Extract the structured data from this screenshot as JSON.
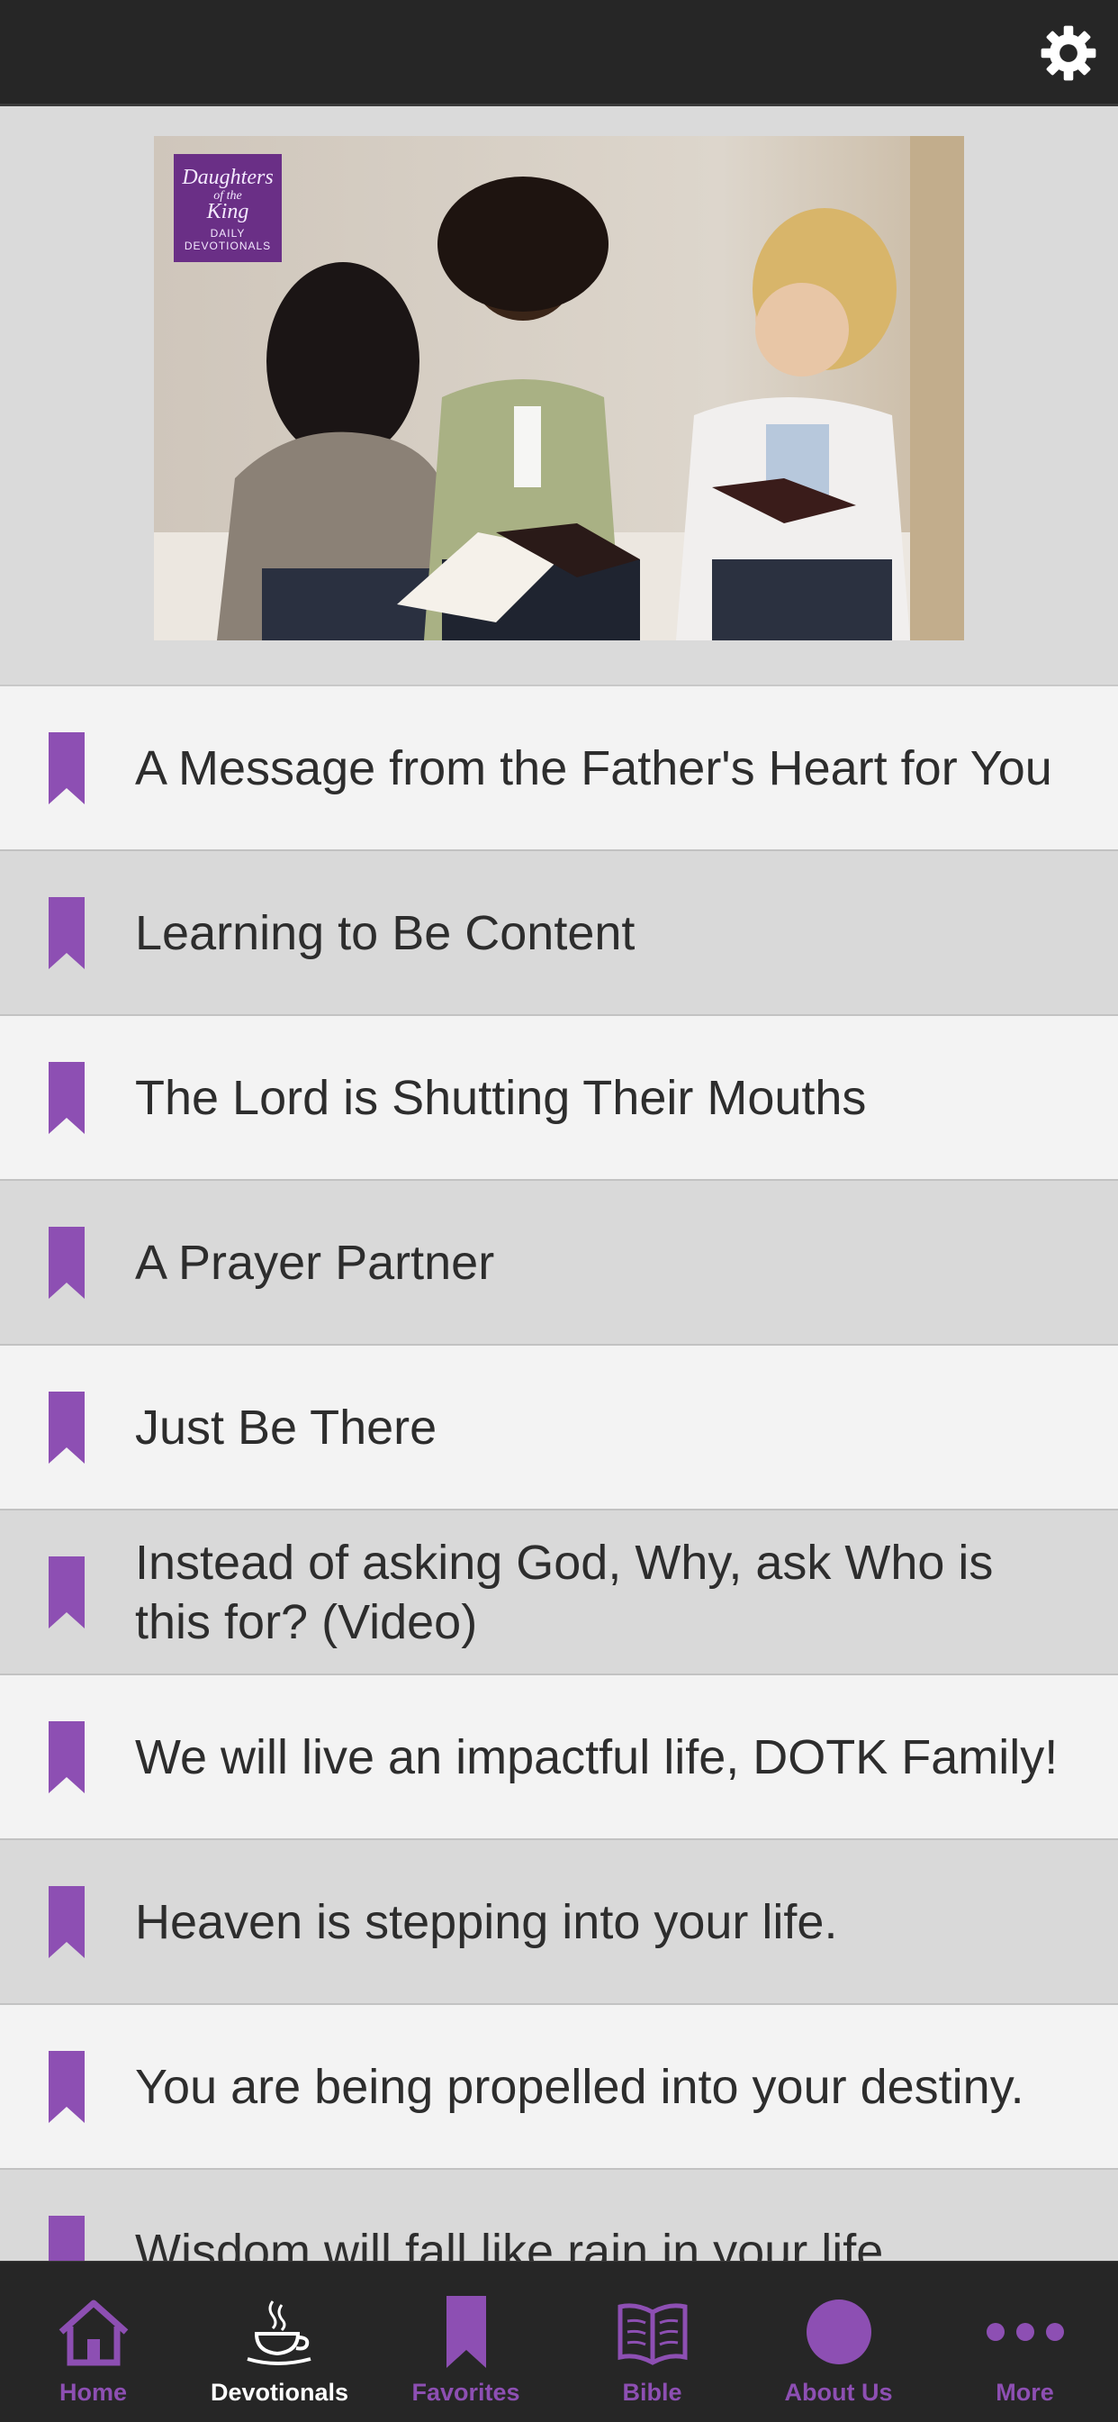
{
  "header": {
    "settings_icon": "gear-icon"
  },
  "hero": {
    "logo": {
      "line1": "Daughters",
      "line2": "of the",
      "line3": "King",
      "line4": "DAILY",
      "line5": "DEVOTIONALS"
    }
  },
  "devotionals": [
    {
      "title": "A Message from the Father's Heart for You"
    },
    {
      "title": "Learning to Be Content"
    },
    {
      "title": "The Lord is Shutting Their Mouths"
    },
    {
      "title": "A Prayer Partner"
    },
    {
      "title": "Just Be There"
    },
    {
      "title": "Instead of asking God, Why, ask Who is this for? (Video)"
    },
    {
      "title": "We will live an impactful life, DOTK Family!"
    },
    {
      "title": "Heaven is stepping into your life."
    },
    {
      "title": "You are being propelled into your destiny."
    },
    {
      "title": "Wisdom will fall like rain in your life."
    }
  ],
  "tabs": [
    {
      "label": "Home",
      "icon": "home-icon"
    },
    {
      "label": "Devotionals",
      "icon": "coffee-cup-icon"
    },
    {
      "label": "Favorites",
      "icon": "bookmark-icon"
    },
    {
      "label": "Bible",
      "icon": "book-icon"
    },
    {
      "label": "About Us",
      "icon": "circle-icon"
    },
    {
      "label": "More",
      "icon": "more-dots-icon"
    }
  ],
  "active_tab": "Devotionals",
  "colors": {
    "accent": "#8d4fb3",
    "bar": "#262626",
    "row_light": "#f3f3f3",
    "row_dark": "#d9d9d9"
  }
}
